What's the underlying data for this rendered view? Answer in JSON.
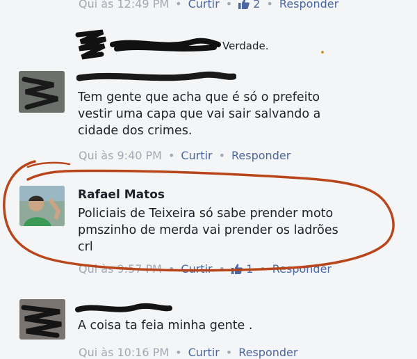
{
  "comments": [
    {
      "id": "c0",
      "time": "Qui às 12:49 PM",
      "like_label": "Curtir",
      "likes": "2",
      "reply_label": "Responder"
    },
    {
      "id": "c1",
      "text": "Verdade."
    },
    {
      "id": "c2",
      "text": "Tem gente que acha que é só o prefeito vestir uma capa que vai sair salvando a cidade dos crimes.",
      "lines": [
        "Tem gente que acha que é só o prefeito",
        "vestir uma capa que vai sair salvando a",
        "cidade dos crimes."
      ],
      "time": "Qui às 9:40 PM",
      "like_label": "Curtir",
      "reply_label": "Responder"
    },
    {
      "id": "c3",
      "author": "Rafael Matos",
      "lines": [
        "Policiais de Teixeira só sabe prender moto",
        "pmszinho de merda vai prender os ladrões",
        "crl"
      ],
      "time": "Qui às 9:57 PM",
      "like_label": "Curtir",
      "likes": "1",
      "reply_label": "Responder"
    },
    {
      "id": "c4",
      "text": "A coisa ta feia minha gente .",
      "time": "Qui às 10:16 PM",
      "like_label": "Curtir",
      "reply_label": "Responder"
    }
  ],
  "colors": {
    "link": "#4b67a1",
    "meta": "#a3a8b3",
    "highlight_circle": "#b8461a"
  },
  "icons": [
    "thumbs-up-icon",
    "redaction-scribble",
    "avatar"
  ]
}
